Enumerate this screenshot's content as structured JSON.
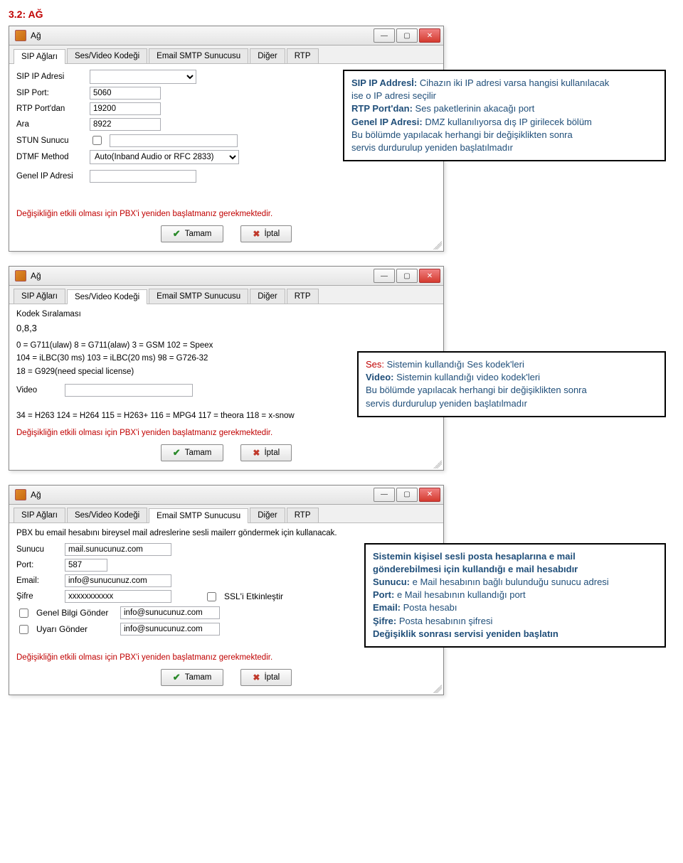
{
  "heading": "3.2: AĞ",
  "common": {
    "window_title": "Ağ",
    "restart_msg": "Değişikliğin etkili olması için PBX'i yeniden başlatmanız gerekmektedir.",
    "ok_label": "Tamam",
    "cancel_label": "İptal"
  },
  "tabs": {
    "t0": "SIP Ağları",
    "t1": "Ses/Video Kodeği",
    "t2": "Email SMTP Sunucusu",
    "t3": "Diğer",
    "t4": "RTP"
  },
  "win1": {
    "labels": {
      "sip_ip": "SIP IP Adresi",
      "sip_port": "SIP Port:",
      "rtp_port": "RTP Port'dan",
      "ara": "Ara",
      "stun": "STUN Sunucu",
      "dtmf": "DTMF Method",
      "genel_ip": "Genel IP Adresi"
    },
    "values": {
      "sip_port": "5060",
      "rtp_port": "19200",
      "ara": "8922",
      "dtmf": "Auto(Inband Audio or RFC 2833)"
    }
  },
  "callout1": {
    "l1a": "SIP IP Addresİ:",
    "l1b": " Cihazın iki IP adresi varsa hangisi kullanılacak",
    "l2": "ise o IP adresi seçilir",
    "l3a": "RTP Port'dan:",
    "l3b": " Ses paketlerinin akacağı port",
    "l4a": "Genel IP Adresi:",
    "l4b": " DMZ kullanılıyorsa dış IP girilecek bölüm",
    "l5": "Bu bölümde yapılacak herhangi bir değişiklikten sonra",
    "l6": "servis durdurulup yeniden başlatılmadır"
  },
  "win2": {
    "sub1": "Kodek Sıralaması",
    "codec_value": "0,8,3",
    "line1": "0 = G711(ulaw)   8 = G711(alaw)   3 = GSM   102 = Speex",
    "line2": "104 = iLBC(30 ms)   103 = iLBC(20 ms)   98 = G726-32",
    "line3": "18 = G929(need special license)",
    "sub2": "Video",
    "video_value": "",
    "line4": "34 = H263  124 = H264  115 = H263+  116 = MPG4  117 = theora  118 = x-snow"
  },
  "callout2": {
    "l1a": "Ses:",
    "l1b": " Sistemin kullandığı Ses kodek'leri",
    "l2a": "Video:",
    "l2b": " Sistemin kullandığı video kodek'leri",
    "l3": "Bu bölümde yapılacak herhangi bir değişiklikten sonra",
    "l4": "servis durdurulup yeniden başlatılmadır"
  },
  "win3": {
    "intro": "PBX bu email hesabını bireysel mail adreslerine sesli mailerr göndermek için kullanacak.",
    "labels": {
      "sunucu": "Sunucu",
      "port": "Port:",
      "email": "Email:",
      "sifre": "Şifre",
      "ssl": "SSL'i Etkinleştir",
      "gbg": "Genel Bilgi Gönder",
      "ug": "Uyarı Gönder"
    },
    "values": {
      "sunucu": "mail.sunucunuz.com",
      "port": "587",
      "email": "info@sunucunuz.com",
      "sifre": "xxxxxxxxxxx",
      "gbg": "info@sunucunuz.com",
      "ug": "info@sunucunuz.com"
    }
  },
  "callout3": {
    "l1": "Sistemin kişisel sesli posta hesaplarına e mail",
    "l2": "gönderebilmesi için kullandığı e mail hesabıdır",
    "l3a": "Sunucu:",
    "l3b": " e Mail hesabının bağlı bulunduğu sunucu adresi",
    "l4a": "Port:",
    "l4b": " e Mail hesabının kullandığı port",
    "l5a": "Email:",
    "l5b": " Posta hesabı",
    "l6a": "Şifre:",
    "l6b": " Posta hesabının şifresi",
    "l7": "Değişiklik sonrası servisi yeniden başlatın"
  }
}
